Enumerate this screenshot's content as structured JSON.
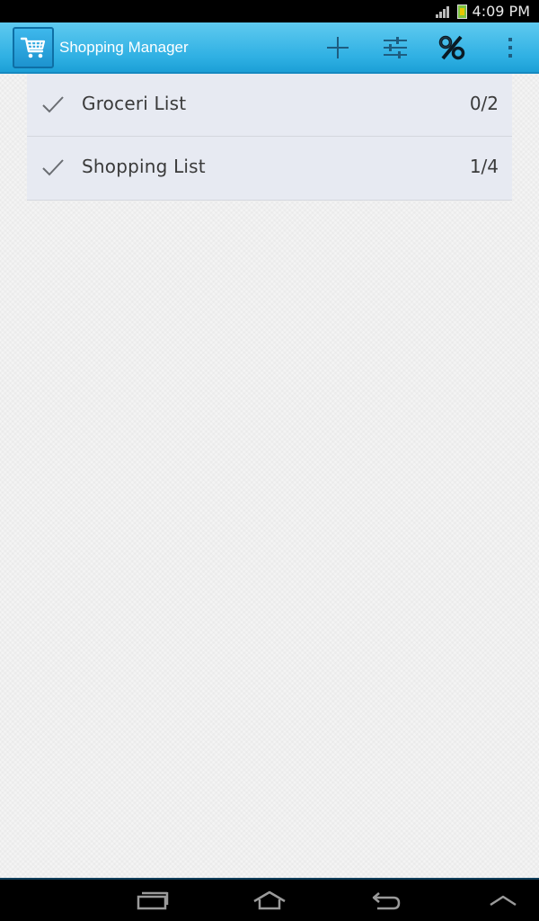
{
  "status_bar": {
    "time": "4:09 PM",
    "icons": [
      "signal-icon",
      "battery-icon"
    ]
  },
  "action_bar": {
    "title": "Shopping Manager",
    "app_icon": "shopping-cart-icon",
    "actions": [
      {
        "name": "add-icon"
      },
      {
        "name": "settings-sliders-icon"
      },
      {
        "name": "percent-icon"
      },
      {
        "name": "overflow-menu-icon"
      }
    ]
  },
  "lists": [
    {
      "label": "Groceri List",
      "count": "0/2",
      "icon": "check-icon"
    },
    {
      "label": "Shopping List",
      "count": "1/4",
      "icon": "check-icon"
    }
  ],
  "nav_bar": {
    "buttons": [
      "recent-apps-icon",
      "home-icon",
      "back-icon",
      "menu-up-icon"
    ]
  },
  "colors": {
    "action_bar": "#2fb0e3",
    "list_item_bg": "#e7eaf2",
    "text": "#3a3a3a"
  }
}
